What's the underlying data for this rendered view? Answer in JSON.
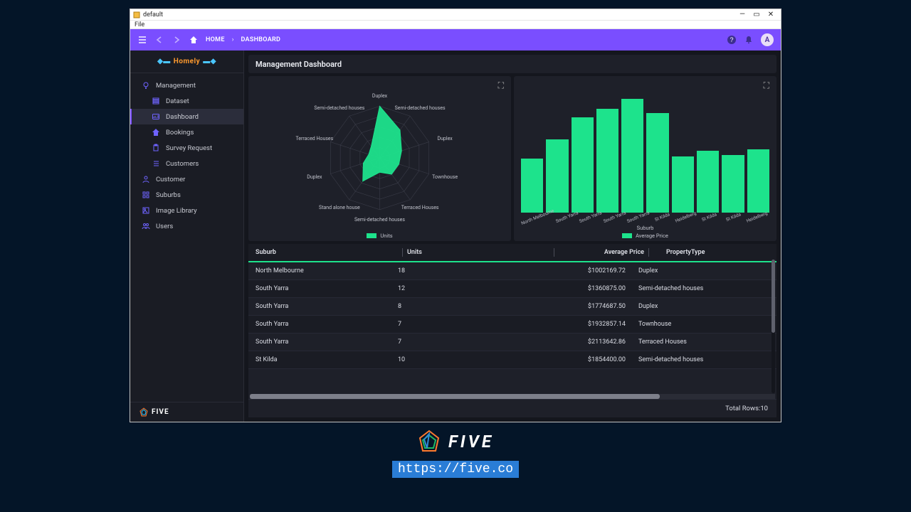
{
  "window": {
    "title": "default",
    "menu_file": "File"
  },
  "topnav": {
    "home": "HOME",
    "crumb": "DASHBOARD",
    "avatar_initial": "A"
  },
  "brand": {
    "name": "Homely"
  },
  "sidebar": {
    "items": [
      {
        "label": "Management",
        "icon": "lightbulb-icon",
        "child": false
      },
      {
        "label": "Dataset",
        "icon": "stack-icon",
        "child": true
      },
      {
        "label": "Dashboard",
        "icon": "gauge-icon",
        "child": true,
        "active": true
      },
      {
        "label": "Bookings",
        "icon": "house-icon",
        "child": true
      },
      {
        "label": "Survey Request",
        "icon": "clipboard-icon",
        "child": true
      },
      {
        "label": "Customers",
        "icon": "list-icon",
        "child": true
      },
      {
        "label": "Customer",
        "icon": "person-icon",
        "child": false
      },
      {
        "label": "Suburbs",
        "icon": "grid-icon",
        "child": false
      },
      {
        "label": "Image Library",
        "icon": "image-icon",
        "child": false
      },
      {
        "label": "Users",
        "icon": "users-icon",
        "child": false
      }
    ],
    "footer_brand": "FIVE"
  },
  "page": {
    "title": "Management Dashboard"
  },
  "chart_data": [
    {
      "type": "radar",
      "title": "",
      "series": [
        {
          "name": "Units",
          "values": [
            18,
            12,
            8,
            7,
            7,
            5,
            10,
            6,
            4,
            5
          ]
        }
      ],
      "categories": [
        "Duplex",
        "Semi-detached houses",
        "Duplex",
        "Townhouse",
        "Terraced Houses",
        "Semi-detached houses",
        "Stand alone house",
        "Duplex",
        "Terraced Houses",
        "Semi-detached houses"
      ],
      "legend": "Units"
    },
    {
      "type": "bar",
      "title": "",
      "xlabel": "Suburb",
      "ylabel": "",
      "categories": [
        "North Melbourne",
        "South Yarra",
        "South Yarra",
        "South Yarra",
        "South Yarra",
        "St Kilda",
        "Heidelberg",
        "St Kilda",
        "St Kilda",
        "Heidelberg"
      ],
      "series": [
        {
          "name": "Average Price",
          "values": [
            1002169.72,
            1360875.0,
            1774687.5,
            1932857.14,
            2113642.86,
            1854400.0,
            1050000,
            1150000,
            1070000,
            1180000
          ]
        }
      ],
      "legend": "Average Price",
      "ylim": [
        0,
        2300000
      ]
    }
  ],
  "table": {
    "columns": [
      "Suburb",
      "Units",
      "Average Price",
      "PropertyType"
    ],
    "rows": [
      {
        "suburb": "North Melbourne",
        "units": "18",
        "price": "$1002169.72",
        "type": "Duplex"
      },
      {
        "suburb": "South Yarra",
        "units": "12",
        "price": "$1360875.00",
        "type": "Semi-detached houses"
      },
      {
        "suburb": "South Yarra",
        "units": "8",
        "price": "$1774687.50",
        "type": "Duplex"
      },
      {
        "suburb": "South Yarra",
        "units": "7",
        "price": "$1932857.14",
        "type": "Townhouse"
      },
      {
        "suburb": "South Yarra",
        "units": "7",
        "price": "$2113642.86",
        "type": "Terraced Houses"
      },
      {
        "suburb": "St Kilda",
        "units": "10",
        "price": "$1854400.00",
        "type": "Semi-detached houses"
      }
    ],
    "footer_prefix": "Total Rows: ",
    "footer_count": "10"
  },
  "footer": {
    "brand": "FIVE",
    "url": "https://five.co"
  }
}
